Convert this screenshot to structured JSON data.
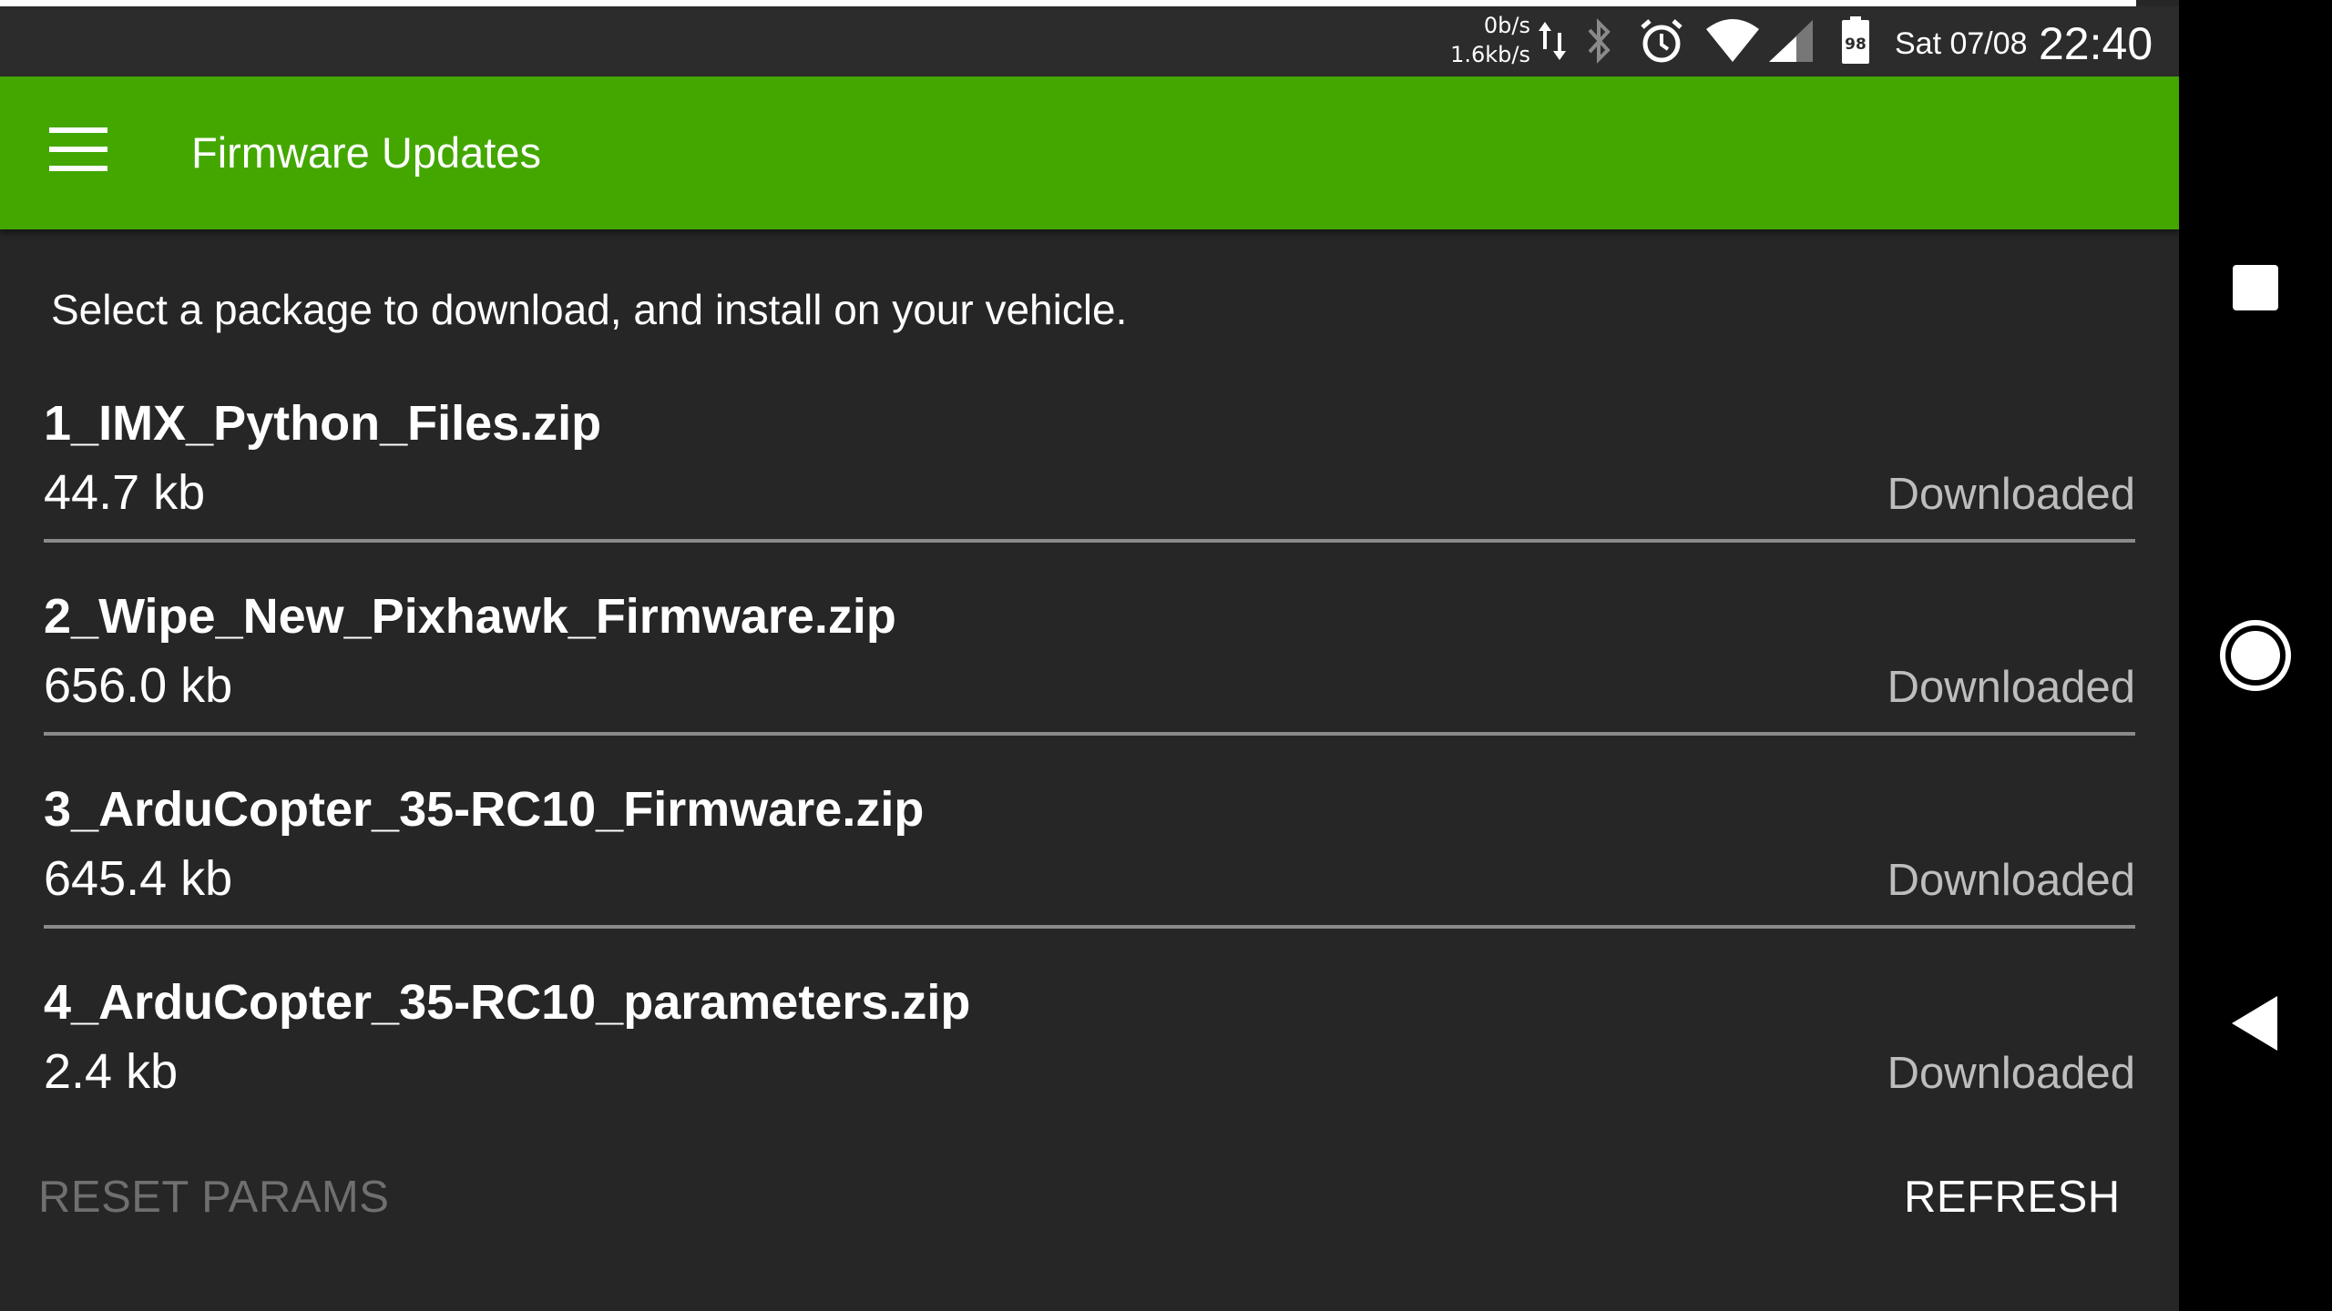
{
  "status_bar": {
    "net_up": "0b/s",
    "net_down": "1.6kb/s",
    "battery": "98",
    "date": "Sat 07/08",
    "time": "22:40",
    "icons": [
      "data-transfer-icon",
      "bluetooth-icon",
      "alarm-icon",
      "wifi-icon",
      "cellular-signal-icon",
      "battery-icon"
    ]
  },
  "app_bar": {
    "title": "Firmware Updates",
    "menu_icon": "hamburger-menu-icon",
    "color": "#43a700"
  },
  "instructions": "Select a package to download, and install on your vehicle.",
  "packages": [
    {
      "name": "1_IMX_Python_Files.zip",
      "size": "44.7 kb",
      "status": "Downloaded"
    },
    {
      "name": "2_Wipe_New_Pixhawk_Firmware.zip",
      "size": "656.0 kb",
      "status": "Downloaded"
    },
    {
      "name": "3_ArduCopter_35-RC10_Firmware.zip",
      "size": "645.4 kb",
      "status": "Downloaded"
    },
    {
      "name": "4_ArduCopter_35-RC10_parameters.zip",
      "size": "2.4 kb",
      "status": "Downloaded"
    }
  ],
  "footer": {
    "reset_label": "RESET PARAMS",
    "refresh_label": "REFRESH"
  },
  "nav_bar": {
    "icons": [
      "recents-square-icon",
      "home-circle-icon",
      "back-triangle-icon"
    ]
  }
}
